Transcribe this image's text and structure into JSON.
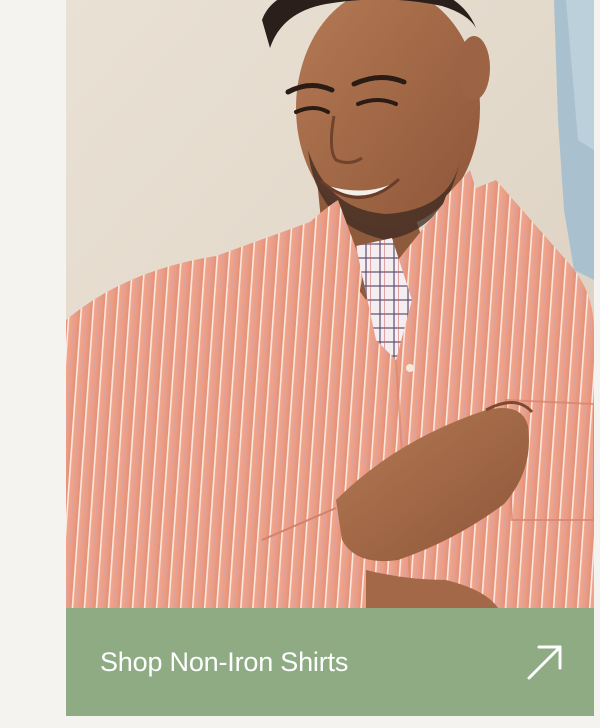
{
  "promo": {
    "cta_label": "Shop Non-Iron Shirts",
    "arrow_icon": "arrow-up-right-icon",
    "image_alt": "man wearing an orange striped button-down shirt"
  },
  "colors": {
    "cta_bar": "#8eab84",
    "page_background": "#f4f3ef",
    "shirt": "#ee9f86"
  }
}
